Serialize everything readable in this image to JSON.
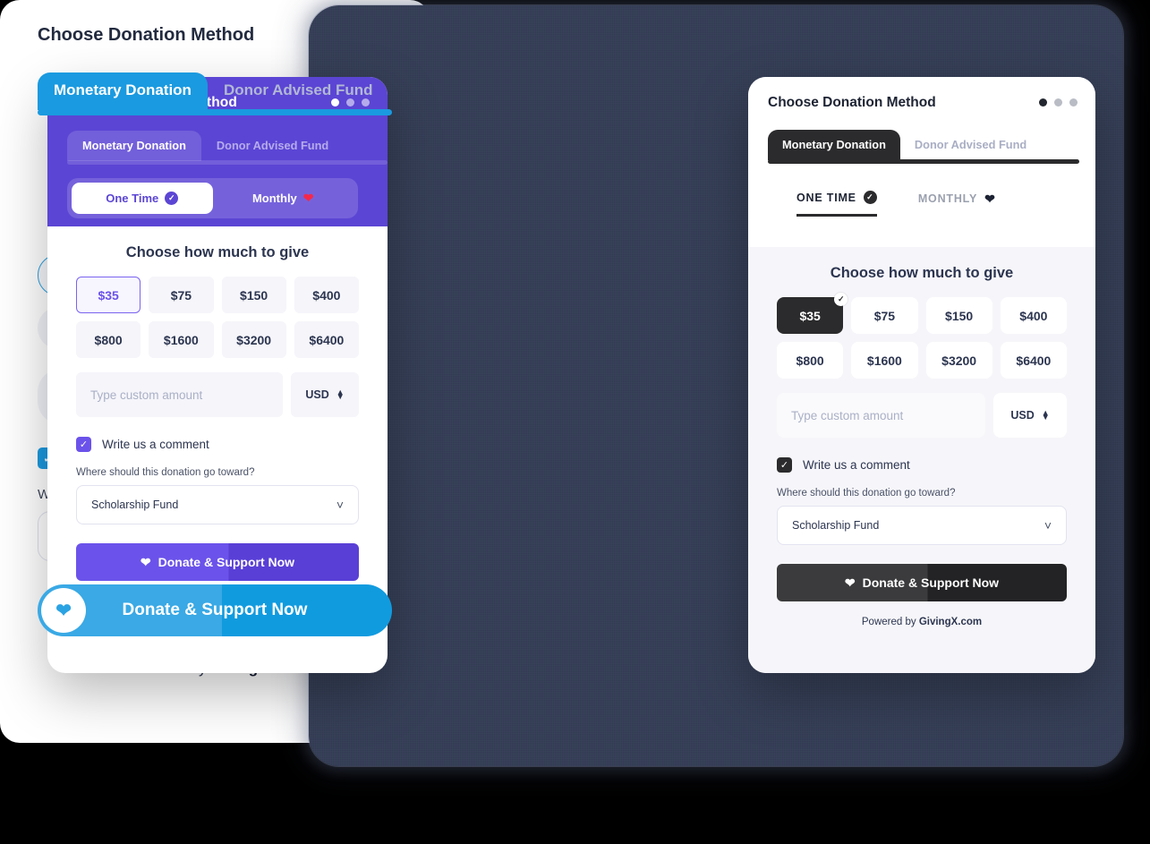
{
  "theme": {
    "purple": "#5b45d4",
    "purple_accent": "#6b52ea",
    "blue": "#1a9ae0",
    "blue_accent": "#2ba3e3",
    "dark": "#2b2b2d",
    "navy_backdrop": "#333d55",
    "heart_red": "#f6284a"
  },
  "common": {
    "title": "Choose Donation Method",
    "tabs": [
      {
        "label": "Monetary Donation",
        "active": true
      },
      {
        "label": "Donor Advised Fund",
        "active": false
      }
    ],
    "frequency": [
      {
        "label": "One Time",
        "active": true,
        "icon": "check-circle-icon"
      },
      {
        "label": "Monthly",
        "active": false,
        "icon": "heart-icon"
      }
    ],
    "frequency_upper": [
      {
        "label": "ONE TIME",
        "active": true,
        "icon": "check-circle-icon"
      },
      {
        "label": "MONTHLY",
        "active": false,
        "icon": "heart-icon"
      }
    ],
    "amount_heading": "Choose how much to give",
    "amounts": [
      "$35",
      "$75",
      "$150",
      "$400",
      "$800",
      "$1600",
      "$3200",
      "$6400"
    ],
    "selected_amount": "$35",
    "custom_amount_placeholder": "Type custom amount",
    "currency": "USD",
    "comment_label": "Write us a comment",
    "comment_checked": true,
    "designation_label": "Where should this donation go toward?",
    "designation_value": "Scholarship Fund",
    "donate_label": "Donate & Support Now",
    "powered_prefix": "Powered by ",
    "powered_brand": "GivingX.com",
    "window_dots": [
      "active",
      "inactive",
      "inactive"
    ]
  }
}
